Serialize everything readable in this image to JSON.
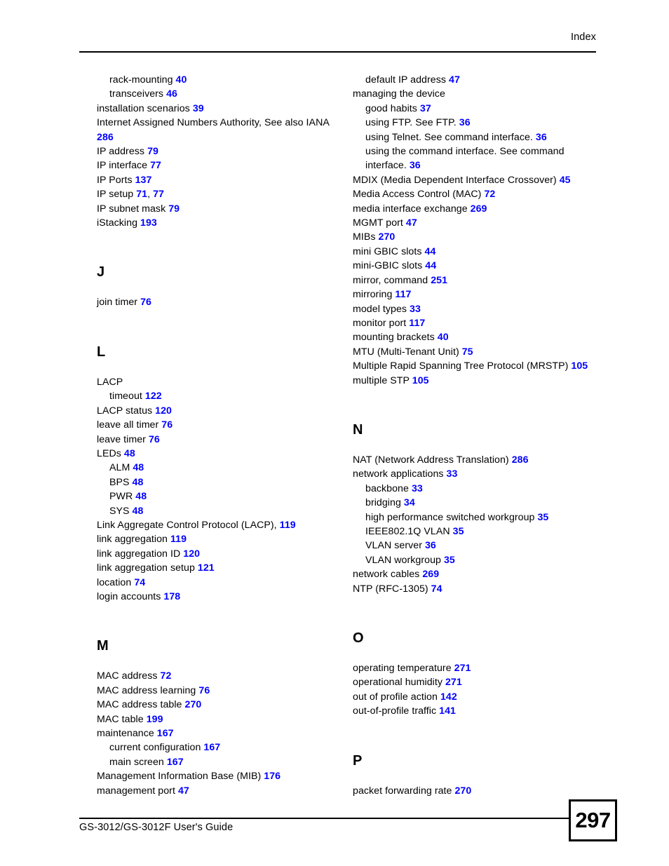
{
  "header": {
    "title": "Index"
  },
  "footer": {
    "guide_title": "GS-3012/GS-3012F User's Guide",
    "page_number": "297"
  },
  "colors": {
    "page_number_link": "#0000ff",
    "text": "#000000",
    "background": "#ffffff"
  },
  "left_column": {
    "blocks": [
      {
        "type": "entries",
        "items": [
          {
            "level": 1,
            "text": "rack-mounting",
            "pages": [
              "40"
            ]
          },
          {
            "level": 1,
            "text": "transceivers",
            "pages": [
              "46"
            ]
          },
          {
            "level": 0,
            "text": "installation scenarios",
            "pages": [
              "39"
            ]
          },
          {
            "level": 0,
            "text": "Internet Assigned Numbers Authority, See also IANA",
            "pages": [
              "286"
            ],
            "wrapped": true
          },
          {
            "level": 0,
            "text": "IP address",
            "pages": [
              "79"
            ]
          },
          {
            "level": 0,
            "text": "IP interface",
            "pages": [
              "77"
            ]
          },
          {
            "level": 0,
            "text": "IP Ports",
            "pages": [
              "137"
            ]
          },
          {
            "level": 0,
            "text": "IP setup",
            "pages": [
              "71",
              "77"
            ]
          },
          {
            "level": 0,
            "text": "IP subnet mask",
            "pages": [
              "79"
            ]
          },
          {
            "level": 0,
            "text": "iStacking",
            "pages": [
              "193"
            ]
          }
        ]
      },
      {
        "type": "letter",
        "letter": "J",
        "items": [
          {
            "level": 0,
            "text": "join timer",
            "pages": [
              "76"
            ]
          }
        ]
      },
      {
        "type": "letter",
        "letter": "L",
        "items": [
          {
            "level": 0,
            "text": "LACP",
            "pages": []
          },
          {
            "level": 1,
            "text": "timeout",
            "pages": [
              "122"
            ]
          },
          {
            "level": 0,
            "text": "LACP status",
            "pages": [
              "120"
            ]
          },
          {
            "level": 0,
            "text": "leave all timer",
            "pages": [
              "76"
            ]
          },
          {
            "level": 0,
            "text": "leave timer",
            "pages": [
              "76"
            ]
          },
          {
            "level": 0,
            "text": "LEDs",
            "pages": [
              "48"
            ]
          },
          {
            "level": 1,
            "text": "ALM",
            "pages": [
              "48"
            ]
          },
          {
            "level": 1,
            "text": "BPS",
            "pages": [
              "48"
            ]
          },
          {
            "level": 1,
            "text": "PWR",
            "pages": [
              "48"
            ]
          },
          {
            "level": 1,
            "text": "SYS",
            "pages": [
              "48"
            ]
          },
          {
            "level": 0,
            "text": "Link Aggregate Control Protocol (LACP),",
            "pages": [
              "119"
            ]
          },
          {
            "level": 0,
            "text": "link aggregation",
            "pages": [
              "119"
            ]
          },
          {
            "level": 0,
            "text": "link aggregation ID",
            "pages": [
              "120"
            ]
          },
          {
            "level": 0,
            "text": "link aggregation setup",
            "pages": [
              "121"
            ]
          },
          {
            "level": 0,
            "text": "location",
            "pages": [
              "74"
            ]
          },
          {
            "level": 0,
            "text": "login accounts",
            "pages": [
              "178"
            ]
          }
        ]
      },
      {
        "type": "letter",
        "letter": "M",
        "items": [
          {
            "level": 0,
            "text": "MAC address",
            "pages": [
              "72"
            ]
          },
          {
            "level": 0,
            "text": "MAC address learning",
            "pages": [
              "76"
            ]
          },
          {
            "level": 0,
            "text": "MAC address table",
            "pages": [
              "270"
            ]
          },
          {
            "level": 0,
            "text": "MAC table",
            "pages": [
              "199"
            ]
          },
          {
            "level": 0,
            "text": "maintenance",
            "pages": [
              "167"
            ]
          },
          {
            "level": 1,
            "text": "current configuration",
            "pages": [
              "167"
            ]
          },
          {
            "level": 1,
            "text": "main screen",
            "pages": [
              "167"
            ]
          },
          {
            "level": 0,
            "text": "Management Information Base (MIB)",
            "pages": [
              "176"
            ]
          },
          {
            "level": 0,
            "text": "management port",
            "pages": [
              "47"
            ]
          }
        ]
      }
    ]
  },
  "right_column": {
    "blocks": [
      {
        "type": "entries",
        "items": [
          {
            "level": 1,
            "text": "default IP address",
            "pages": [
              "47"
            ]
          },
          {
            "level": 0,
            "text": "managing the device",
            "pages": []
          },
          {
            "level": 1,
            "text": "good habits",
            "pages": [
              "37"
            ]
          },
          {
            "level": 1,
            "text": "using FTP. See FTP.",
            "pages": [
              "36"
            ]
          },
          {
            "level": 1,
            "text": "using Telnet. See command interface.",
            "pages": [
              "36"
            ]
          },
          {
            "level": 1,
            "text": "using the command interface. See command interface.",
            "pages": [
              "36"
            ],
            "wrapped": true
          },
          {
            "level": 0,
            "text": "MDIX (Media Dependent Interface Crossover)",
            "pages": [
              "45"
            ]
          },
          {
            "level": 0,
            "text": "Media Access Control (MAC)",
            "pages": [
              "72"
            ]
          },
          {
            "level": 0,
            "text": "media interface exchange",
            "pages": [
              "269"
            ]
          },
          {
            "level": 0,
            "text": "MGMT port",
            "pages": [
              "47"
            ]
          },
          {
            "level": 0,
            "text": "MIBs",
            "pages": [
              "270"
            ]
          },
          {
            "level": 0,
            "text": "mini GBIC slots",
            "pages": [
              "44"
            ]
          },
          {
            "level": 0,
            "text": "mini-GBIC slots",
            "pages": [
              "44"
            ]
          },
          {
            "level": 0,
            "text": "mirror, command",
            "pages": [
              "251"
            ]
          },
          {
            "level": 0,
            "text": "mirroring",
            "pages": [
              "117"
            ]
          },
          {
            "level": 0,
            "text": "model types",
            "pages": [
              "33"
            ]
          },
          {
            "level": 0,
            "text": "monitor port",
            "pages": [
              "117"
            ]
          },
          {
            "level": 0,
            "text": "mounting brackets",
            "pages": [
              "40"
            ]
          },
          {
            "level": 0,
            "text": "MTU (Multi-Tenant Unit)",
            "pages": [
              "75"
            ]
          },
          {
            "level": 0,
            "text": "Multiple Rapid Spanning Tree Protocol (MRSTP)",
            "pages": [
              "105"
            ]
          },
          {
            "level": 0,
            "text": "multiple STP",
            "pages": [
              "105"
            ]
          }
        ]
      },
      {
        "type": "letter",
        "letter": "N",
        "items": [
          {
            "level": 0,
            "text": "NAT (Network Address Translation)",
            "pages": [
              "286"
            ]
          },
          {
            "level": 0,
            "text": "network applications",
            "pages": [
              "33"
            ]
          },
          {
            "level": 1,
            "text": "backbone",
            "pages": [
              "33"
            ]
          },
          {
            "level": 1,
            "text": "bridging",
            "pages": [
              "34"
            ]
          },
          {
            "level": 1,
            "text": "high performance switched workgroup",
            "pages": [
              "35"
            ]
          },
          {
            "level": 1,
            "text": "IEEE802.1Q VLAN",
            "pages": [
              "35"
            ]
          },
          {
            "level": 1,
            "text": "VLAN server",
            "pages": [
              "36"
            ]
          },
          {
            "level": 1,
            "text": "VLAN workgroup",
            "pages": [
              "35"
            ]
          },
          {
            "level": 0,
            "text": "network cables",
            "pages": [
              "269"
            ]
          },
          {
            "level": 0,
            "text": "NTP (RFC-1305)",
            "pages": [
              "74"
            ]
          }
        ]
      },
      {
        "type": "letter",
        "letter": "O",
        "items": [
          {
            "level": 0,
            "text": "operating temperature",
            "pages": [
              "271"
            ]
          },
          {
            "level": 0,
            "text": "operational humidity",
            "pages": [
              "271"
            ]
          },
          {
            "level": 0,
            "text": "out of profile action",
            "pages": [
              "142"
            ]
          },
          {
            "level": 0,
            "text": "out-of-profile traffic",
            "pages": [
              "141"
            ]
          }
        ]
      },
      {
        "type": "letter",
        "letter": "P",
        "items": [
          {
            "level": 0,
            "text": "packet forwarding rate",
            "pages": [
              "270"
            ]
          }
        ]
      }
    ]
  }
}
